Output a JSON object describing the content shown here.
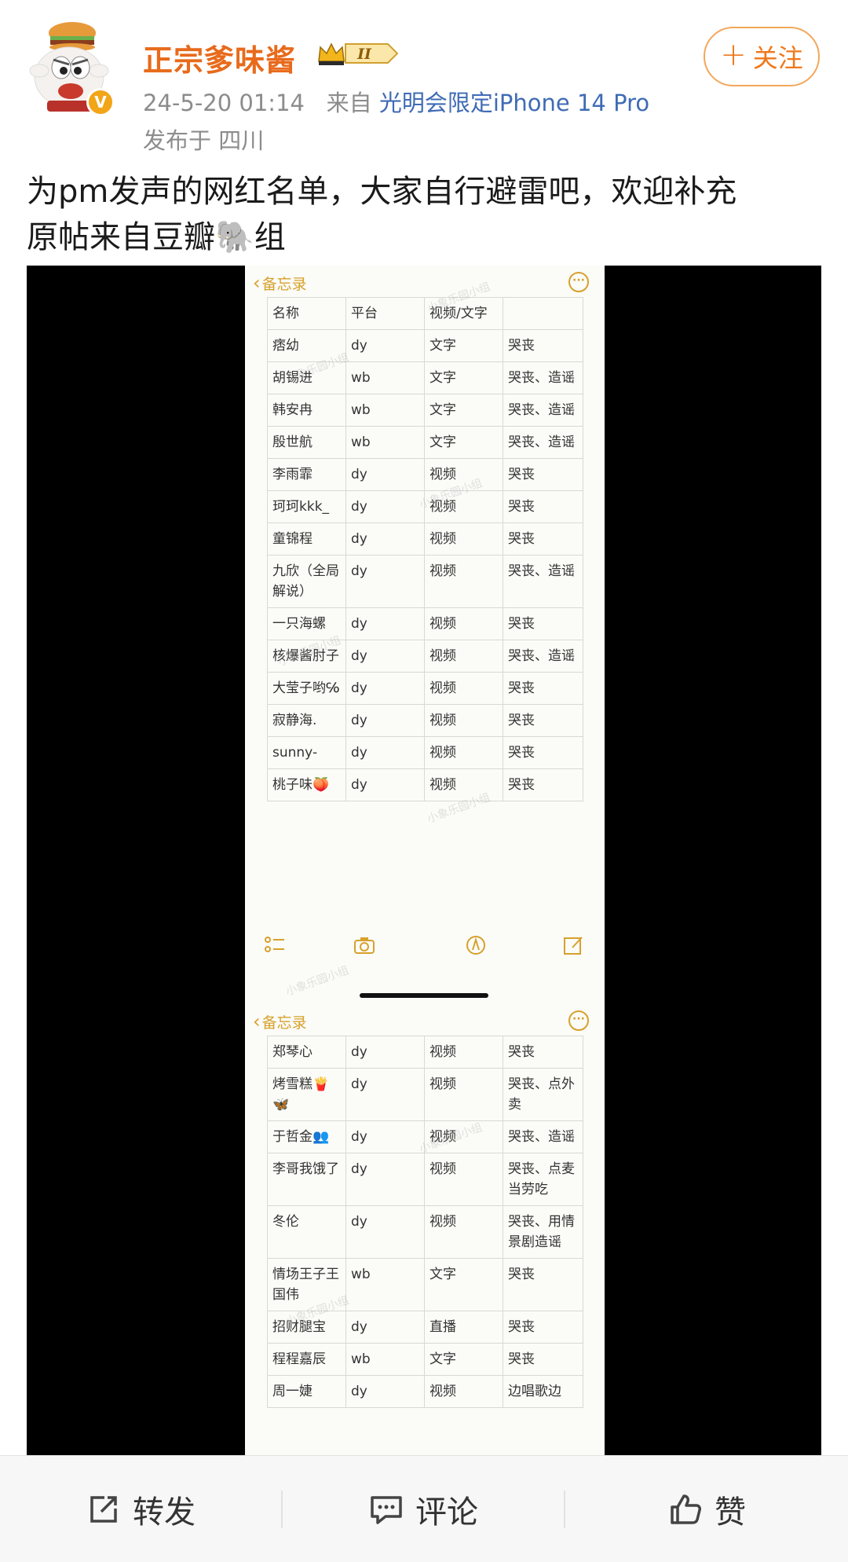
{
  "header": {
    "username": "正宗爹味酱",
    "vip_level": "II",
    "verified": "V",
    "timestamp": "24-5-20 01:14",
    "source_prefix": "来自",
    "device": "光明会限定iPhone 14 Pro",
    "location": "发布于 四川",
    "follow_label": "关注",
    "follow_plus": "+"
  },
  "post": {
    "line1": "为pm发声的网红名单，大家自行避雷吧，欢迎补充",
    "line2": "原帖来自豆瓣🐘组"
  },
  "screenshot": {
    "back_label": "备忘录",
    "more_label": "···",
    "watermark": "小象乐园小组",
    "table1": [
      [
        "名称",
        "平台",
        "视频/文字",
        ""
      ],
      [
        "痞幼",
        "dy",
        "文字",
        "哭丧"
      ],
      [
        "胡锡进",
        "wb",
        "文字",
        "哭丧、造谣"
      ],
      [
        "韩安冉",
        "wb",
        "文字",
        "哭丧、造谣"
      ],
      [
        "殷世航",
        "wb",
        "文字",
        "哭丧、造谣"
      ],
      [
        "李雨霏",
        "dy",
        "视频",
        "哭丧"
      ],
      [
        "珂珂kkk_",
        "dy",
        "视频",
        "哭丧"
      ],
      [
        "童锦程",
        "dy",
        "视频",
        "哭丧"
      ],
      [
        "九欣（全局解说）",
        "dy",
        "视频",
        "哭丧、造谣"
      ],
      [
        "一只海螺",
        "dy",
        "视频",
        "哭丧"
      ],
      [
        "核爆酱肘子",
        "dy",
        "视频",
        "哭丧、造谣"
      ],
      [
        "大莹子哟℅",
        "dy",
        "视频",
        "哭丧"
      ],
      [
        "寂静海.",
        "dy",
        "视频",
        "哭丧"
      ],
      [
        "sunny-",
        "dy",
        "视频",
        "哭丧"
      ],
      [
        "桃子味🍑",
        "dy",
        "视频",
        "哭丧"
      ]
    ],
    "table2": [
      [
        "郑琴心",
        "dy",
        "视频",
        "哭丧"
      ],
      [
        "烤雪糕🍟🦋",
        "dy",
        "视频",
        "哭丧、点外卖"
      ],
      [
        "于哲金👥",
        "dy",
        "视频",
        "哭丧、造谣"
      ],
      [
        "李哥我饿了",
        "dy",
        "视频",
        "哭丧、点麦当劳吃"
      ],
      [
        "冬伦",
        "dy",
        "视频",
        "哭丧、用情景剧造谣"
      ],
      [
        "情场王子王国伟",
        "wb",
        "文字",
        "哭丧"
      ],
      [
        "招财腿宝",
        "dy",
        "直播",
        "哭丧"
      ],
      [
        "程程嘉辰",
        "wb",
        "文字",
        "哭丧"
      ],
      [
        "周一婕",
        "dy",
        "视频",
        "边唱歌边"
      ]
    ]
  },
  "actions": {
    "repost_label": "转发",
    "comment_label": "评论",
    "like_label": "赞"
  },
  "colors": {
    "username": "#e86a1b",
    "device_link": "#3f6bb5",
    "follow_border": "#f3a75a",
    "notes_accent": "#d7a12b"
  },
  "icons": {
    "repost": "share-out-icon",
    "comment": "comment-bubble-icon",
    "like": "thumbs-up-icon"
  }
}
